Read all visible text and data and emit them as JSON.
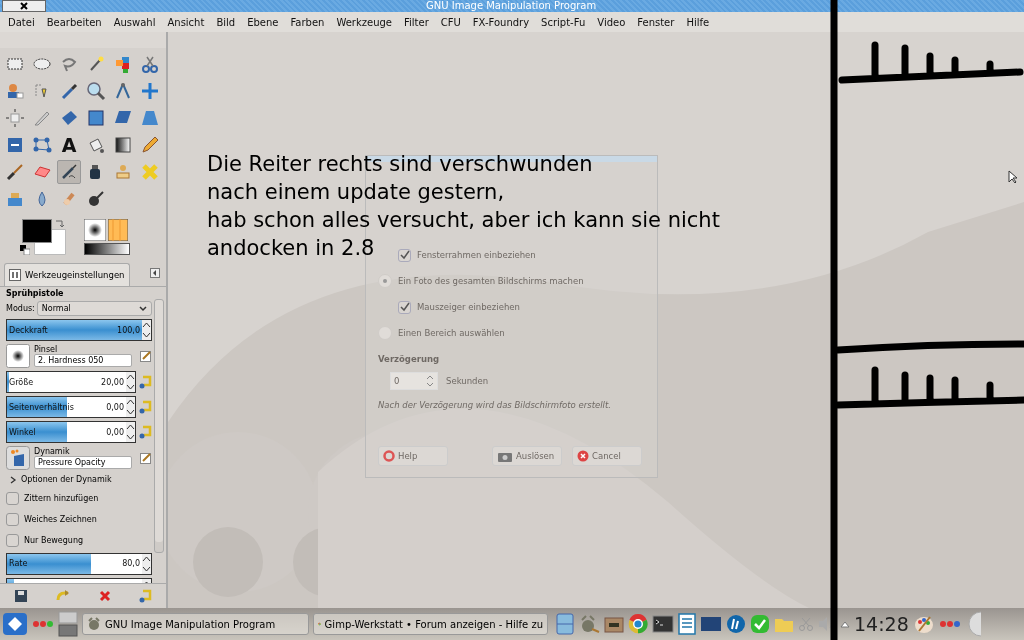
{
  "window": {
    "title": "GNU Image Manipulation Program"
  },
  "menu": [
    "Datei",
    "Bearbeiten",
    "Auswahl",
    "Ansicht",
    "Bild",
    "Ebene",
    "Farben",
    "Werkzeuge",
    "Filter",
    "CFU",
    "FX-Foundry",
    "Script-Fu",
    "Video",
    "Fenster",
    "Hilfe"
  ],
  "tools": [
    {
      "selected": false
    },
    {
      "selected": false
    },
    {
      "selected": false
    },
    {
      "selected": false
    },
    {
      "selected": false
    },
    {
      "selected": false
    },
    {
      "selected": false
    },
    {
      "selected": false
    },
    {
      "selected": false
    },
    {
      "selected": false
    },
    {
      "selected": false
    },
    {
      "selected": false
    },
    {
      "selected": false
    },
    {
      "selected": false
    },
    {
      "selected": false
    },
    {
      "selected": false
    },
    {
      "selected": false
    },
    {
      "selected": false
    },
    {
      "selected": false
    },
    {
      "selected": false
    },
    {
      "selected": false,
      "label": "A"
    },
    {
      "selected": false
    },
    {
      "selected": false
    },
    {
      "selected": false
    },
    {
      "selected": false
    },
    {
      "selected": false
    },
    {
      "selected": true
    },
    {
      "selected": false
    },
    {
      "selected": false
    },
    {
      "selected": false
    },
    {
      "selected": false
    },
    {
      "selected": false
    },
    {
      "selected": false
    },
    {
      "selected": false
    }
  ],
  "dock_tab": {
    "label": "Werkzeugeinstellungen"
  },
  "tool_options": {
    "title": "Sprühpistole",
    "mode_label": "Modus:",
    "mode": "Normal",
    "opacity": {
      "label": "Deckkraft",
      "value": "100,0",
      "level": 1.0
    },
    "brush_label": "Pinsel",
    "brush": "2. Hardness 050",
    "sliders": [
      {
        "label": "Größe",
        "value": "20,00",
        "level": 0.02
      },
      {
        "label": "Seitenverhältnis",
        "value": "0,00",
        "level": 0.5
      },
      {
        "label": "Winkel",
        "value": "0,00",
        "level": 0.5
      }
    ],
    "dynamics_label": "Dynamik",
    "dynamics": "Pressure Opacity",
    "dynamics_options": {
      "label": "Optionen der Dynamik",
      "expanded": false
    },
    "checkboxes": [
      {
        "label": "Zittern hinzufügen",
        "checked": false
      },
      {
        "label": "Weiches Zeichnen",
        "checked": false
      },
      {
        "label": "Nur Bewegung",
        "checked": false
      }
    ],
    "rate": {
      "label": "Rate",
      "value": "80,0",
      "level": 0.62
    },
    "flow": {
      "level": 0.05
    }
  },
  "dialog": {
    "options": [
      {
        "kind": "checkbox",
        "label": "Fensterrahmen einbeziehen",
        "checked": true
      },
      {
        "kind": "radio",
        "label": "Ein Foto des gesamten Bildschirms machen",
        "selected": true
      },
      {
        "kind": "checkbox",
        "label": "Mauszeiger einbeziehen",
        "checked": true
      },
      {
        "kind": "radio",
        "label": "Einen Bereich auswählen",
        "selected": false
      }
    ],
    "delay_heading": "Verzögerung",
    "delay_value": "0",
    "delay_unit": "Sekunden",
    "hint": "Nach der Verzögerung wird das Bildschirmfoto erstellt.",
    "buttons": [
      {
        "label": "Help"
      },
      {
        "label": "Auslösen"
      },
      {
        "label": "Cancel"
      }
    ]
  },
  "note": [
    "Die Reiter rechts sind verschwunden",
    "nach einem update gestern,",
    "hab schon alles versucht, aber ich kann sie nicht",
    "andocken in 2.8"
  ],
  "taskbar": {
    "tasks": [
      {
        "label": "GNU Image Manipulation Program"
      },
      {
        "label": "Gimp-Werkstatt • Forum anzeigen - Hilfe zu"
      }
    ],
    "clock": "14:28"
  }
}
